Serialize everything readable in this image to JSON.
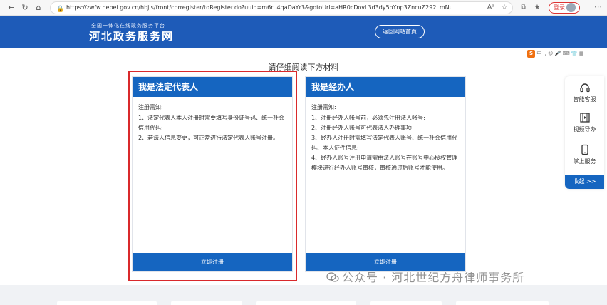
{
  "browser": {
    "url": "https://zwfw.hebei.gov.cn/hbjis/front/corregister/toRegister.do?uuid=m6ru4qaDaYr3&gotoUrl=aHR0cDovL3d3dy5oYnp3ZncuZ292LmNu",
    "login_label": "登录",
    "font_label": "Aᵃ"
  },
  "header": {
    "subtitle": "全国一体化在线政务服务平台",
    "title": "河北政务服务网",
    "home_button": "返回网站首页"
  },
  "page": {
    "instruction": "请仔细阅读下方材料"
  },
  "cards": {
    "legal": {
      "title": "我是法定代表人",
      "notice_title": "注册需知:",
      "items": [
        "1、法定代表人本人注册时需要填写身份证号码、统一社会信用代码;",
        "2、若法人信息变更，可正常进行法定代表人账号注册。"
      ],
      "button": "立即注册"
    },
    "agent": {
      "title": "我是经办人",
      "notice_title": "注册需知:",
      "items": [
        "1、注册经办人帐号前，必须先注册法人帐号;",
        "2、注册经办人账号可代表法人办理事项;",
        "3、经办人注册时需填写法定代表人账号、统一社会信用代码、本人证件信息;",
        "4、经办人账号注册申请需由法人账号在账号中心授权管理模块进行经办人账号审核，审核通过后账号才能使用。"
      ],
      "button": "立即注册"
    }
  },
  "side_panel": {
    "items": [
      {
        "label": "智能客服",
        "icon": "headset-icon"
      },
      {
        "label": "视频导办",
        "icon": "film-icon"
      },
      {
        "label": "掌上服务",
        "icon": "phone-icon"
      }
    ],
    "collapse": "收起 >>"
  },
  "watermark": "公众号 · 河北世纪方舟律师事务所",
  "colors": {
    "header_blue": "#1e5bb8",
    "card_blue": "#1565c0",
    "highlight_red": "#d9292b"
  }
}
